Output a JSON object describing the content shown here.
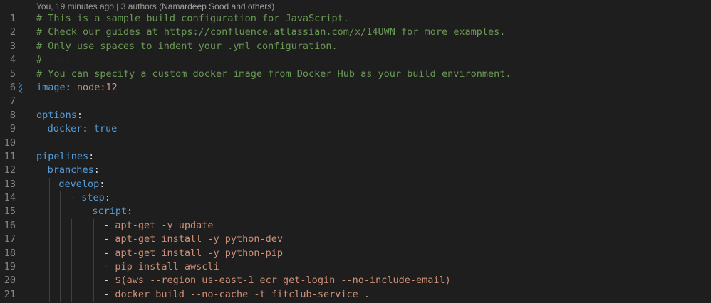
{
  "codelens": "You, 19 minutes ago | 3 authors (Namardeep Sood and others)",
  "lines": [
    {
      "n": "1",
      "indent": 0,
      "parts": [
        {
          "t": "# This is a sample build configuration for JavaScript.",
          "c": "cm"
        }
      ]
    },
    {
      "n": "2",
      "indent": 0,
      "parts": [
        {
          "t": "# Check our guides at ",
          "c": "cm"
        },
        {
          "t": "https://confluence.atlassian.com/x/14UWN",
          "c": "url"
        },
        {
          "t": " for more examples.",
          "c": "cm"
        }
      ]
    },
    {
      "n": "3",
      "indent": 0,
      "parts": [
        {
          "t": "# Only use spaces to indent your .yml configuration.",
          "c": "cm"
        }
      ]
    },
    {
      "n": "4",
      "indent": 0,
      "parts": [
        {
          "t": "# -----",
          "c": "cm"
        }
      ]
    },
    {
      "n": "5",
      "indent": 0,
      "parts": [
        {
          "t": "# You can specify a custom docker image from Docker Hub as your build environment.",
          "c": "cm"
        }
      ]
    },
    {
      "n": "6",
      "indent": 0,
      "modified": true,
      "parts": [
        {
          "t": "image",
          "c": "key"
        },
        {
          "t": ": ",
          "c": "pun"
        },
        {
          "t": "node:12",
          "c": "val"
        }
      ]
    },
    {
      "n": "7",
      "indent": 0,
      "parts": []
    },
    {
      "n": "8",
      "indent": 0,
      "parts": [
        {
          "t": "options",
          "c": "key"
        },
        {
          "t": ":",
          "c": "pun"
        }
      ]
    },
    {
      "n": "9",
      "indent": 1,
      "parts": [
        {
          "t": "docker",
          "c": "key"
        },
        {
          "t": ": ",
          "c": "pun"
        },
        {
          "t": "true",
          "c": "bool"
        }
      ]
    },
    {
      "n": "10",
      "indent": 0,
      "parts": []
    },
    {
      "n": "11",
      "indent": 0,
      "parts": [
        {
          "t": "pipelines",
          "c": "key"
        },
        {
          "t": ":",
          "c": "pun"
        }
      ]
    },
    {
      "n": "12",
      "indent": 1,
      "parts": [
        {
          "t": "branches",
          "c": "key"
        },
        {
          "t": ":",
          "c": "pun"
        }
      ]
    },
    {
      "n": "13",
      "indent": 2,
      "parts": [
        {
          "t": "develop",
          "c": "key"
        },
        {
          "t": ":",
          "c": "pun"
        }
      ]
    },
    {
      "n": "14",
      "indent": 3,
      "parts": [
        {
          "t": "- ",
          "c": "pun"
        },
        {
          "t": "step",
          "c": "key"
        },
        {
          "t": ":",
          "c": "pun"
        }
      ]
    },
    {
      "n": "15",
      "indent": 5,
      "parts": [
        {
          "t": "script",
          "c": "key"
        },
        {
          "t": ":",
          "c": "pun"
        }
      ]
    },
    {
      "n": "16",
      "indent": 6,
      "parts": [
        {
          "t": "- ",
          "c": "pun"
        },
        {
          "t": "apt-get -y update",
          "c": "val"
        }
      ]
    },
    {
      "n": "17",
      "indent": 6,
      "parts": [
        {
          "t": "- ",
          "c": "pun"
        },
        {
          "t": "apt-get install -y python-dev",
          "c": "val"
        }
      ]
    },
    {
      "n": "18",
      "indent": 6,
      "parts": [
        {
          "t": "- ",
          "c": "pun"
        },
        {
          "t": "apt-get install -y python-pip",
          "c": "val"
        }
      ]
    },
    {
      "n": "19",
      "indent": 6,
      "parts": [
        {
          "t": "- ",
          "c": "pun"
        },
        {
          "t": "pip install awscli",
          "c": "val"
        }
      ]
    },
    {
      "n": "20",
      "indent": 6,
      "parts": [
        {
          "t": "- ",
          "c": "pun"
        },
        {
          "t": "$(aws --region us-east-1 ecr get-login --no-include-email)",
          "c": "val"
        }
      ]
    },
    {
      "n": "21",
      "indent": 6,
      "parts": [
        {
          "t": "- ",
          "c": "pun"
        },
        {
          "t": "docker build --no-cache -t fitclub-service .",
          "c": "val"
        }
      ]
    }
  ]
}
